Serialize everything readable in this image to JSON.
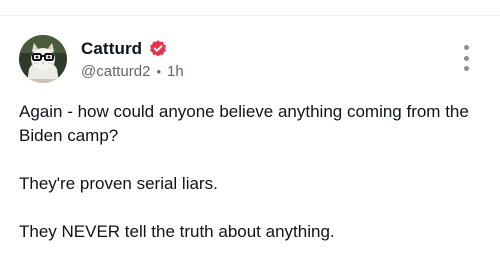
{
  "post": {
    "author": {
      "display_name": "Catturd",
      "handle": "@catturd2",
      "verified_icon": "verified-badge-icon",
      "verified_color": "#e8344f",
      "avatar_icon": "cat-with-glasses-avatar"
    },
    "separator": "•",
    "timestamp": "1h",
    "more_icon": "vertical-ellipsis-icon",
    "paragraphs": [
      "Again - how could anyone believe anything coming from the Biden camp?",
      "They're proven serial liars.",
      "They NEVER tell the truth about anything."
    ]
  }
}
